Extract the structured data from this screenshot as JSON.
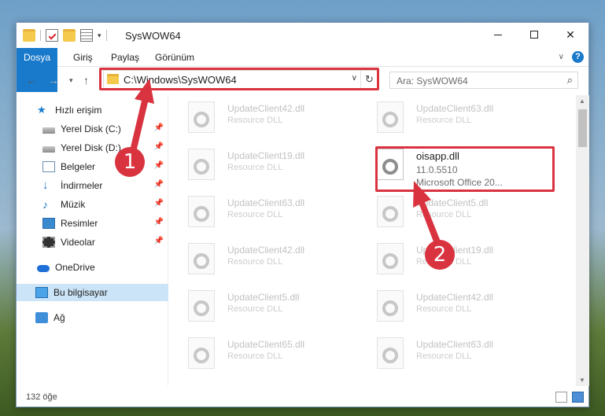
{
  "window": {
    "title": "SysWOW64",
    "controls": {
      "minimize": "—",
      "maximize": "☐",
      "close": "✕"
    }
  },
  "ribbon": {
    "tabs": [
      "Dosya",
      "Giriş",
      "Paylaş",
      "Görünüm"
    ]
  },
  "navigation": {
    "address_path": "C:\\Windows\\SysWOW64",
    "search_placeholder": "Ara: SysWOW64"
  },
  "sidebar": {
    "items": [
      {
        "label": "Hızlı erişim",
        "icon": "star-icon"
      },
      {
        "label": "Yerel Disk (C:)",
        "icon": "drive-icon",
        "pinned": true
      },
      {
        "label": "Yerel Disk (D:)",
        "icon": "drive-icon",
        "pinned": true
      },
      {
        "label": "Belgeler",
        "icon": "documents-icon",
        "pinned": true
      },
      {
        "label": "İndirmeler",
        "icon": "downloads-icon",
        "pinned": true
      },
      {
        "label": "Müzik",
        "icon": "music-icon",
        "pinned": true
      },
      {
        "label": "Resimler",
        "icon": "pictures-icon",
        "pinned": true
      },
      {
        "label": "Videolar",
        "icon": "videos-icon",
        "pinned": true
      },
      {
        "label": "OneDrive",
        "icon": "onedrive-icon"
      },
      {
        "label": "Bu bilgisayar",
        "icon": "computer-icon",
        "selected": true
      },
      {
        "label": "Ağ",
        "icon": "network-icon"
      }
    ]
  },
  "files": {
    "left": [
      {
        "name": "UpdateClient42.dll",
        "type": "Resource DLL"
      },
      {
        "name": "UpdateClient19.dll",
        "type": "Resource DLL"
      },
      {
        "name": "UpdateClient63.dll",
        "type": "Resource DLL"
      },
      {
        "name": "UpdateClient42.dll",
        "type": "Resource DLL"
      },
      {
        "name": "UpdateClient5.dll",
        "type": "Resource DLL"
      },
      {
        "name": "UpdateClient65.dll",
        "type": "Resource DLL"
      }
    ],
    "right": [
      {
        "name": "UpdateClient63.dll",
        "type": "Resource DLL"
      },
      {
        "name": "UpdateClient5.dll",
        "type": "Resource DLL"
      },
      {
        "name": "UpdateClient19.dll",
        "type": "Resource DLL"
      },
      {
        "name": "UpdateClient42.dll",
        "type": "Resource DLL"
      },
      {
        "name": "UpdateClient63.dll",
        "type": "Resource DLL"
      }
    ],
    "highlighted": {
      "name": "oisapp.dll",
      "version": "11.0.5510",
      "description": "Microsoft Office 20..."
    }
  },
  "status": {
    "item_count": "132 öğe"
  },
  "annotations": {
    "step1": "1",
    "step2": "2",
    "color": "#d9333f"
  }
}
